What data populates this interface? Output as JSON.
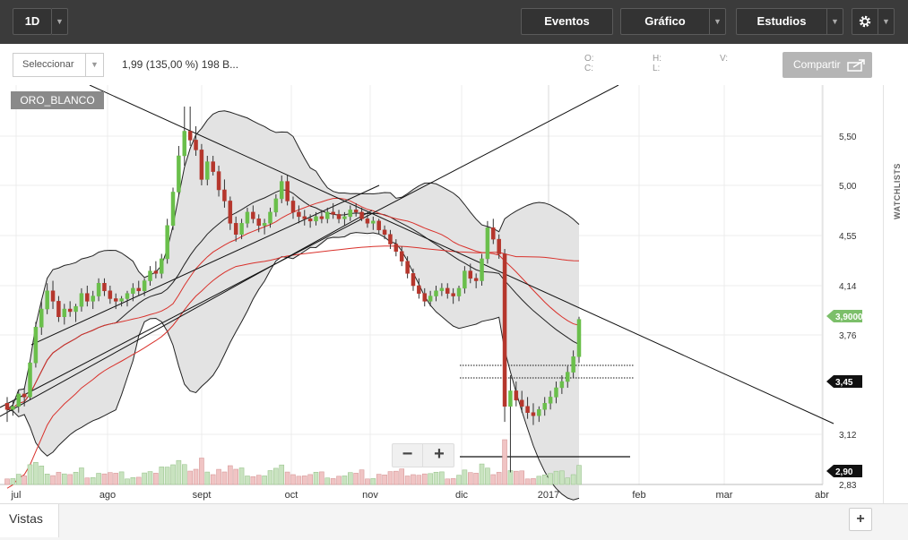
{
  "toolbar": {
    "period": "1D",
    "eventos": "Eventos",
    "grafico": "Gráfico",
    "estudios": "Estudios"
  },
  "subbar": {
    "select_label": "Seleccionar",
    "info": "1,99 (135,00 %) 198 B...",
    "o_label": "O:",
    "h_label": "H:",
    "v_label": "V:",
    "c_label": "C:",
    "l_label": "L:",
    "share": "Compartir"
  },
  "side": {
    "watchlists": "WATCHLISTS"
  },
  "bottom": {
    "vistas": "Vistas",
    "add": "+"
  },
  "zoom": {
    "minus": "−",
    "plus": "+"
  },
  "chart_data": {
    "type": "candlestick",
    "symbol": "ORO_BLANCO",
    "x_ticks": [
      "jul",
      "ago",
      "sept",
      "oct",
      "nov",
      "dic",
      "2017",
      "feb",
      "mar",
      "abr"
    ],
    "y_ticks": [
      "5,50",
      "5,00",
      "4,55",
      "4,14",
      "3,76",
      "3,12",
      "2,83"
    ],
    "price_labels": [
      {
        "value": "3,9000",
        "color": "#7cbf6a"
      },
      {
        "value": "3,45",
        "color": "#111111"
      },
      {
        "value": "2,90",
        "color": "#111111"
      }
    ],
    "candles": [
      [
        3.32,
        3.36,
        3.2,
        3.28
      ],
      [
        3.28,
        3.34,
        3.24,
        3.3
      ],
      [
        3.3,
        3.4,
        3.26,
        3.38
      ],
      [
        3.38,
        3.42,
        3.3,
        3.36
      ],
      [
        3.36,
        3.6,
        3.34,
        3.58
      ],
      [
        3.58,
        3.86,
        3.55,
        3.82
      ],
      [
        3.82,
        4.02,
        3.76,
        3.96
      ],
      [
        3.96,
        4.16,
        3.92,
        4.1
      ],
      [
        4.1,
        4.18,
        3.96,
        4.02
      ],
      [
        4.02,
        4.06,
        3.86,
        3.9
      ],
      [
        3.9,
        4.0,
        3.84,
        3.96
      ],
      [
        3.96,
        4.02,
        3.9,
        3.94
      ],
      [
        3.94,
        4.0,
        3.86,
        3.98
      ],
      [
        3.98,
        4.12,
        3.94,
        4.08
      ],
      [
        4.08,
        4.14,
        3.98,
        4.02
      ],
      [
        4.02,
        4.1,
        3.96,
        4.06
      ],
      [
        4.06,
        4.2,
        4.02,
        4.16
      ],
      [
        4.16,
        4.2,
        4.06,
        4.1
      ],
      [
        4.1,
        4.14,
        4.0,
        4.04
      ],
      [
        4.04,
        4.08,
        3.96,
        4.02
      ],
      [
        4.02,
        4.06,
        3.98,
        4.04
      ],
      [
        4.04,
        4.1,
        3.98,
        4.08
      ],
      [
        4.08,
        4.16,
        4.02,
        4.12
      ],
      [
        4.12,
        4.18,
        4.06,
        4.1
      ],
      [
        4.1,
        4.2,
        4.06,
        4.18
      ],
      [
        4.18,
        4.3,
        4.14,
        4.26
      ],
      [
        4.26,
        4.34,
        4.2,
        4.24
      ],
      [
        4.24,
        4.4,
        4.2,
        4.36
      ],
      [
        4.36,
        4.7,
        4.32,
        4.64
      ],
      [
        4.64,
        4.98,
        4.6,
        4.94
      ],
      [
        4.94,
        5.4,
        4.9,
        5.3
      ],
      [
        5.3,
        5.8,
        5.2,
        5.55
      ],
      [
        5.55,
        5.8,
        5.4,
        5.46
      ],
      [
        5.46,
        5.6,
        5.3,
        5.36
      ],
      [
        5.36,
        5.42,
        5.0,
        5.06
      ],
      [
        5.06,
        5.3,
        5.0,
        5.24
      ],
      [
        5.24,
        5.3,
        5.1,
        5.14
      ],
      [
        5.14,
        5.2,
        4.9,
        4.96
      ],
      [
        4.96,
        5.06,
        4.8,
        4.86
      ],
      [
        4.86,
        4.9,
        4.6,
        4.66
      ],
      [
        4.66,
        4.72,
        4.5,
        4.56
      ],
      [
        4.56,
        4.7,
        4.52,
        4.66
      ],
      [
        4.66,
        4.8,
        4.62,
        4.76
      ],
      [
        4.76,
        4.82,
        4.66,
        4.7
      ],
      [
        4.7,
        4.74,
        4.58,
        4.64
      ],
      [
        4.64,
        4.7,
        4.56,
        4.66
      ],
      [
        4.66,
        4.8,
        4.62,
        4.76
      ],
      [
        4.76,
        4.92,
        4.72,
        4.88
      ],
      [
        4.88,
        5.1,
        4.84,
        5.04
      ],
      [
        5.04,
        5.1,
        4.82,
        4.86
      ],
      [
        4.86,
        4.9,
        4.7,
        4.76
      ],
      [
        4.76,
        4.82,
        4.66,
        4.72
      ],
      [
        4.72,
        4.78,
        4.64,
        4.7
      ],
      [
        4.7,
        4.74,
        4.62,
        4.68
      ],
      [
        4.68,
        4.76,
        4.64,
        4.72
      ],
      [
        4.72,
        4.78,
        4.66,
        4.7
      ],
      [
        4.7,
        4.8,
        4.66,
        4.76
      ],
      [
        4.76,
        4.84,
        4.7,
        4.74
      ],
      [
        4.74,
        4.78,
        4.66,
        4.7
      ],
      [
        4.7,
        4.76,
        4.64,
        4.72
      ],
      [
        4.72,
        4.82,
        4.68,
        4.78
      ],
      [
        4.78,
        4.84,
        4.72,
        4.76
      ],
      [
        4.76,
        4.8,
        4.68,
        4.7
      ],
      [
        4.7,
        4.74,
        4.62,
        4.66
      ],
      [
        4.66,
        4.72,
        4.6,
        4.68
      ],
      [
        4.68,
        4.7,
        4.56,
        4.6
      ],
      [
        4.6,
        4.64,
        4.52,
        4.56
      ],
      [
        4.56,
        4.6,
        4.44,
        4.48
      ],
      [
        4.48,
        4.52,
        4.38,
        4.42
      ],
      [
        4.42,
        4.46,
        4.3,
        4.34
      ],
      [
        4.34,
        4.38,
        4.2,
        4.24
      ],
      [
        4.24,
        4.28,
        4.1,
        4.14
      ],
      [
        4.14,
        4.2,
        4.04,
        4.08
      ],
      [
        4.08,
        4.12,
        3.98,
        4.02
      ],
      [
        4.02,
        4.1,
        3.98,
        4.06
      ],
      [
        4.06,
        4.14,
        4.02,
        4.1
      ],
      [
        4.1,
        4.16,
        4.06,
        4.12
      ],
      [
        4.12,
        4.16,
        4.04,
        4.08
      ],
      [
        4.08,
        4.12,
        4.0,
        4.06
      ],
      [
        4.06,
        4.14,
        4.02,
        4.12
      ],
      [
        4.12,
        4.3,
        4.08,
        4.26
      ],
      [
        4.26,
        4.32,
        4.16,
        4.2
      ],
      [
        4.2,
        4.24,
        4.12,
        4.18
      ],
      [
        4.18,
        4.4,
        4.14,
        4.36
      ],
      [
        4.36,
        4.68,
        4.32,
        4.62
      ],
      [
        4.62,
        4.7,
        4.48,
        4.52
      ],
      [
        4.52,
        4.56,
        4.36,
        4.4
      ],
      [
        4.4,
        4.44,
        3.2,
        3.3
      ],
      [
        3.3,
        3.5,
        2.9,
        3.4
      ],
      [
        3.4,
        3.46,
        3.3,
        3.34
      ],
      [
        3.34,
        3.4,
        3.26,
        3.3
      ],
      [
        3.3,
        3.36,
        3.22,
        3.26
      ],
      [
        3.26,
        3.32,
        3.18,
        3.24
      ],
      [
        3.24,
        3.3,
        3.2,
        3.28
      ],
      [
        3.28,
        3.36,
        3.24,
        3.32
      ],
      [
        3.32,
        3.4,
        3.28,
        3.36
      ],
      [
        3.36,
        3.46,
        3.32,
        3.42
      ],
      [
        3.42,
        3.5,
        3.38,
        3.46
      ],
      [
        3.46,
        3.56,
        3.42,
        3.52
      ],
      [
        3.52,
        3.66,
        3.48,
        3.62
      ],
      [
        3.62,
        3.9,
        3.58,
        3.88
      ]
    ]
  }
}
